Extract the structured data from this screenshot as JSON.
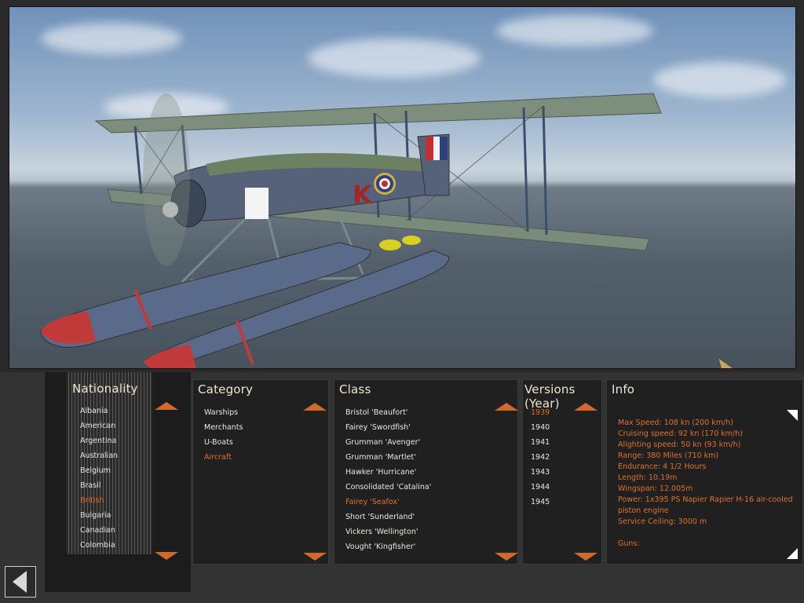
{
  "nationality": {
    "title": "Nationality",
    "items": [
      "Albania",
      "American",
      "Argentina",
      "Australian",
      "Belgium",
      "Brasil",
      "British",
      "Bulgaria",
      "Canadian",
      "Colombia"
    ],
    "selected": "British"
  },
  "category": {
    "title": "Category",
    "items": [
      "Warships",
      "Merchants",
      "U-Boats",
      "Aircraft"
    ],
    "selected": "Aircraft"
  },
  "class": {
    "title": "Class",
    "items": [
      "Bristol 'Beaufort'",
      "Fairey 'Swordfish'",
      "Grumman 'Avenger'",
      "Grumman 'Martlet'",
      "Hawker 'Hurricane'",
      "Consolidated 'Catalina'",
      "Fairey 'Seafox'",
      "Short 'Sunderland'",
      "Vickers 'Wellington'",
      "Vought 'Kingfisher'"
    ],
    "selected": "Fairey 'Seafox'"
  },
  "versions": {
    "title": "Versions (Year)",
    "items": [
      "1939",
      "1940",
      "1941",
      "1942",
      "1943",
      "1944",
      "1945"
    ],
    "selected": "1939"
  },
  "info": {
    "title": "Info",
    "lines": [
      "Max Speed: 108 kn (200 km/h)",
      "Cruising speed: 92 kn (170 km/h)",
      "Alighting speed: 50 kn (93 km/h)",
      "Range: 380 Miles (710 km)",
      "Endurance: 4 1/2 Hours",
      "Length: 10.19m",
      "Wingspan: 12.005m",
      "Power: 1x395 PS Napier Rapier H-16 air-cooled",
      "piston engine",
      "Service Ceiling: 3000 m",
      "",
      "Guns:"
    ]
  },
  "colors": {
    "accent": "#e0702a",
    "arrow": "#d06a2a",
    "title": "#f0e6cf",
    "text": "#e8e8e0"
  },
  "icons": {
    "back": "chevron-left-icon",
    "scroll_up": "triangle-up-icon",
    "scroll_down": "triangle-down-icon"
  }
}
